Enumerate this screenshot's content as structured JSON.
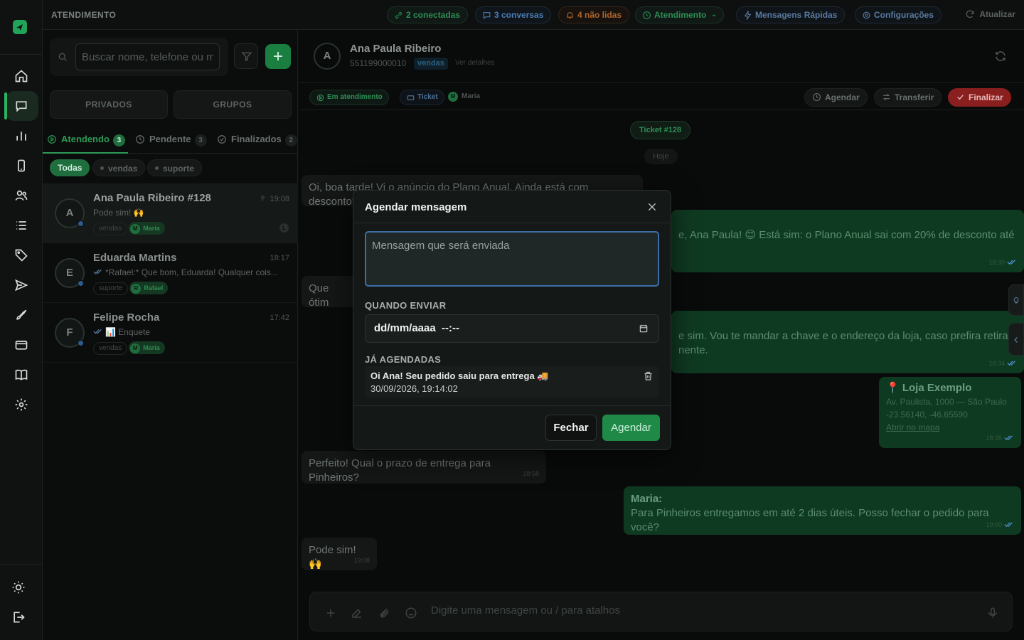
{
  "topbar": {
    "title": "ATENDIMENTO",
    "chips": {
      "connected": "2 conectadas",
      "conversations": "3 conversas",
      "unread": "4 não lidas",
      "status": "Atendimento",
      "quick": "Mensagens Rápidas",
      "settings": "Configurações"
    },
    "refresh": "Atualizar"
  },
  "sidebar": {
    "icons": [
      "home-icon",
      "chat-icon",
      "chart-icon",
      "phone-icon",
      "users-icon",
      "list-icon",
      "tag-icon",
      "send-icon",
      "rocket-icon",
      "card-icon",
      "book-icon",
      "gear-icon"
    ],
    "bottom_icons": [
      "sun-icon",
      "logout-icon"
    ]
  },
  "conversations_panel": {
    "search_placeholder": "Buscar nome, telefone ou m",
    "segments": {
      "private": "PRIVADOS",
      "groups": "GRUPOS"
    },
    "tabs": [
      {
        "label": "Atendendo",
        "count": "3"
      },
      {
        "label": "Pendente",
        "count": "3"
      },
      {
        "label": "Finalizados",
        "count": "2"
      }
    ],
    "filters": {
      "all": "Todas",
      "tag1": "vendas",
      "tag2": "suporte"
    },
    "items": [
      {
        "initial": "A",
        "name": "Ana Paula Ribeiro #128",
        "time": "19:08",
        "preview": "Pode sim! 🙌",
        "tag": "vendas",
        "user_initial": "M",
        "user": "Maria",
        "badge": "L"
      },
      {
        "initial": "E",
        "name": "Eduarda Martins",
        "time": "18:17",
        "preview": "*Rafael:* Que bom, Eduarda! Qualquer cois...",
        "tag": "suporte",
        "user_initial": "R",
        "user": "Rafael"
      },
      {
        "initial": "F",
        "name": "Felipe Rocha",
        "time": "17:42",
        "preview": "📊 Enquete",
        "tag": "vendas",
        "user_initial": "M",
        "user": "Maria"
      }
    ]
  },
  "chat": {
    "contact_initial": "A",
    "contact_name": "Ana Paula Ribeiro",
    "phone": "551199000010",
    "department": "vendas",
    "details_link": "Ver detalhes",
    "status_badge": "Em atendimento",
    "ticket_badge": "Ticket",
    "agent_initial": "M",
    "agent": "Maria",
    "actions": {
      "schedule": "Agendar",
      "transfer": "Transferir",
      "finish": "Finalizar"
    },
    "ticket_pill": "Ticket #128",
    "day_pill": "Hoje",
    "messages": [
      {
        "text": "Oi, boa tarde! Vi o anúncio do Plano Anual. Ainda está com desconto?"
      },
      {
        "text": "e, Ana Paula! 😊 Está sim: o Plano Anual sai com 20% de desconto até",
        "time": "18:30"
      },
      {
        "text": "Que ótim"
      },
      {
        "text": "e sim. Vou te mandar a chave e o endereço da loja, caso prefira retirar",
        "text2": "nente.",
        "time": "18:34"
      },
      {
        "loc_title": "📍 Loja Exemplo",
        "loc_addr": "Av. Paulista, 1000 — São Paulo",
        "loc_coords": "-23.56140, -46.65590",
        "loc_link": "Abrir no mapa",
        "time": "18:35"
      },
      {
        "text": "Perfeito! Qual o prazo de entrega para Pinheiros?",
        "time": "18:58"
      },
      {
        "author": "Maria:",
        "text": "Para Pinheiros entregamos em até 2 dias úteis. Posso fechar o pedido para você?",
        "time": "19:00"
      },
      {
        "text": "Pode sim! 🙌",
        "time": "19:08"
      }
    ],
    "composer_placeholder": "Digite uma mensagem ou / para atalhos"
  },
  "modal": {
    "title": "Agendar mensagem",
    "message_placeholder": "Mensagem que será enviada",
    "when_label": "QUANDO ENVIAR",
    "datetime_value": "dd/mm/aaaa  --:--",
    "scheduled_label": "JÁ AGENDADAS",
    "scheduled": [
      {
        "text": "Oi Ana! Seu pedido saiu para entrega 🚚",
        "date": "30/09/2026, 19:14:02"
      }
    ],
    "close_button": "Fechar",
    "schedule_button": "Agendar"
  },
  "colors": {
    "accent": "#1f8a48",
    "danger": "#8a1f1f",
    "focus": "#3d6ea8"
  }
}
